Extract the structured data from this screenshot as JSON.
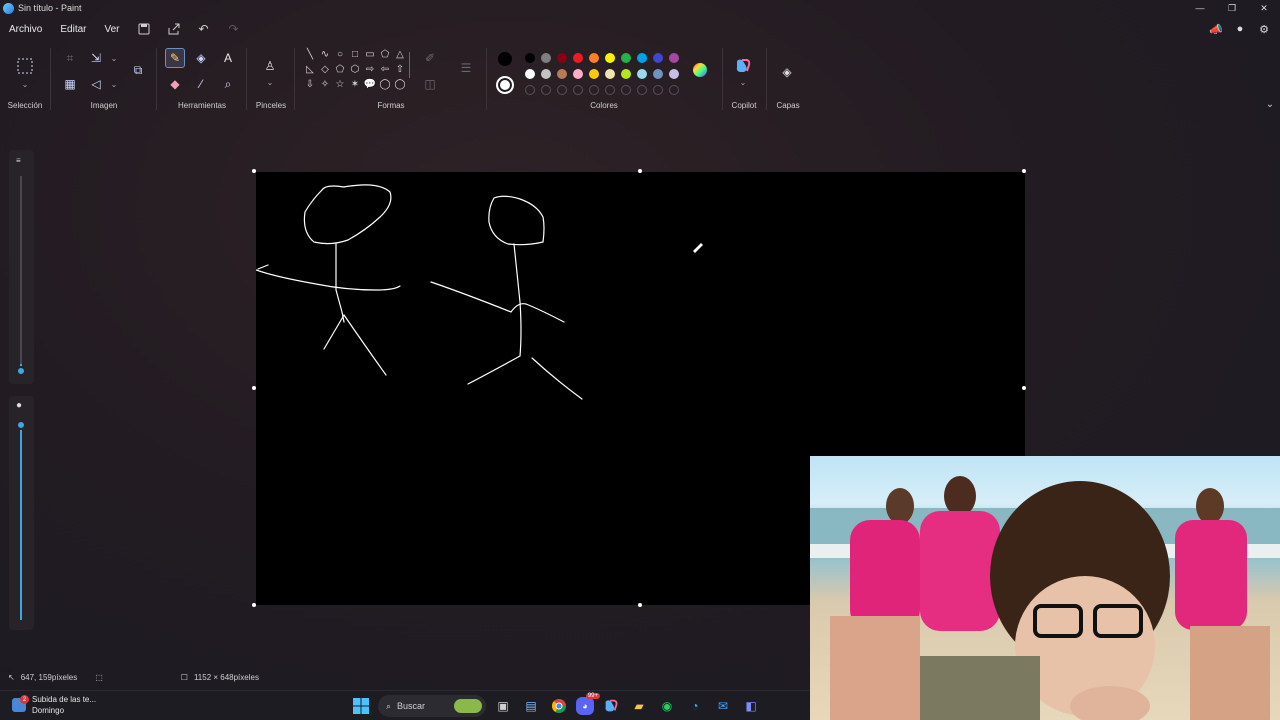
{
  "window": {
    "title": "Sin título - Paint",
    "controls": [
      "—",
      "❐",
      "✕"
    ]
  },
  "menu": {
    "items": [
      "Archivo",
      "Editar",
      "Ver"
    ]
  },
  "ribbon": {
    "groups": {
      "selection": "Selección",
      "image": "Imagen",
      "tools": "Herramientas",
      "brushes": "Pinceles",
      "shapes": "Formas",
      "colors": "Colores",
      "copilot": "Copilot",
      "layers": "Capas"
    },
    "shape_glyphs": [
      "╲",
      "∿",
      "○",
      "□",
      "▭",
      "⬠",
      "△",
      "◺",
      "◇",
      "⬠",
      "⬡",
      "⇨",
      "⇦",
      "⇧",
      "⇩",
      "✧",
      "☆",
      "✶",
      "💬",
      "◯",
      "◯"
    ],
    "colors": {
      "primary": "#000000",
      "secondary": "#ffffff",
      "palette_row1": [
        "#000000",
        "#7f7f7f",
        "#880015",
        "#ed1c24",
        "#ff7f27",
        "#fff200",
        "#22b14c",
        "#00a2e8",
        "#3f48cc",
        "#a349a4"
      ],
      "palette_row2": [
        "#ffffff",
        "#c3c3c3",
        "#b97a57",
        "#ffaec9",
        "#ffc90e",
        "#efe4b0",
        "#b5e61d",
        "#99d9ea",
        "#7092be",
        "#c8bfe7"
      ]
    }
  },
  "status": {
    "cursor_position": "647, 159píxeles",
    "canvas_size": "1152 × 648píxeles"
  },
  "taskbar": {
    "news_title": "Subida de las te...",
    "news_subtitle": "Domingo",
    "news_badge": "2",
    "search_placeholder": "Buscar",
    "discord_badge": "99+"
  }
}
